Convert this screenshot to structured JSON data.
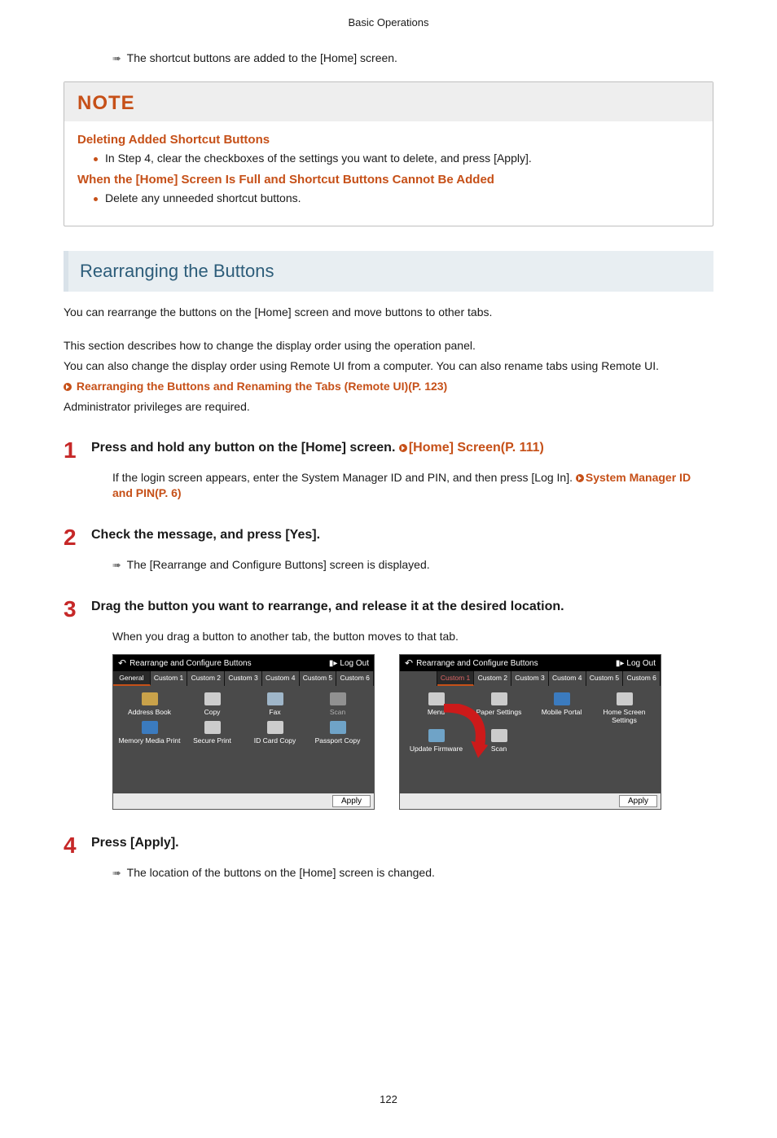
{
  "header": "Basic Operations",
  "result_shortcut_added": "The shortcut buttons are added to the [Home] screen.",
  "note": {
    "title": "NOTE",
    "sub1": "Deleting Added Shortcut Buttons",
    "line1": "In Step 4, clear the checkboxes of the settings you want to delete, and press [Apply].",
    "sub2": "When the [Home] Screen Is Full and Shortcut Buttons Cannot Be Added",
    "line2": "Delete any unneeded shortcut buttons."
  },
  "section_title": "Rearranging the Buttons",
  "intro1": "You can rearrange the buttons on the [Home] screen and move buttons to other tabs.",
  "intro2": "This section describes how to change the display order using the operation panel.",
  "intro3": "You can also change the display order using Remote UI from a computer. You can also rename tabs using Remote UI.",
  "intro_link": "Rearranging the Buttons and Renaming the Tabs (Remote UI)(P. 123)",
  "intro4": "Administrator privileges are required.",
  "step1": {
    "title_a": "Press and hold any button on the [Home] screen. ",
    "title_link": "[Home] Screen(P. 111)",
    "body_a": "If the login screen appears, enter the System Manager ID and PIN, and then press [Log In]. ",
    "body_link": "System Manager ID and PIN(P. 6)"
  },
  "step2": {
    "title": "Check the message, and press [Yes].",
    "result": "The [Rearrange and Configure Buttons] screen is displayed."
  },
  "step3": {
    "title": "Drag the button you want to rearrange, and release it at the desired location.",
    "body": "When you drag a button to another tab, the button moves to that tab."
  },
  "step4": {
    "title": "Press [Apply].",
    "result": "The location of the buttons on the [Home] screen is changed."
  },
  "device": {
    "top_title": "Rearrange and Configure Buttons",
    "logout": "Log Out",
    "apply": "Apply",
    "left_tabs": [
      "General",
      "Custom 1",
      "Custom 2",
      "Custom 3",
      "Custom 4",
      "Custom 5",
      "Custom 6"
    ],
    "left_grid": [
      "Address Book",
      "Copy",
      "Fax",
      "Scan",
      "Memory Media Print",
      "Secure Print",
      "ID Card Copy",
      "Passport Copy"
    ],
    "right_tabs": [
      "",
      "Custom 1",
      "Custom 2",
      "Custom 3",
      "Custom 4",
      "Custom 5",
      "Custom 6"
    ],
    "right_grid": [
      "Menu",
      "Paper Settings",
      "Mobile Portal",
      "Home Screen Settings",
      "Update Firmware",
      "Scan",
      "",
      ""
    ]
  },
  "page_number": "122"
}
